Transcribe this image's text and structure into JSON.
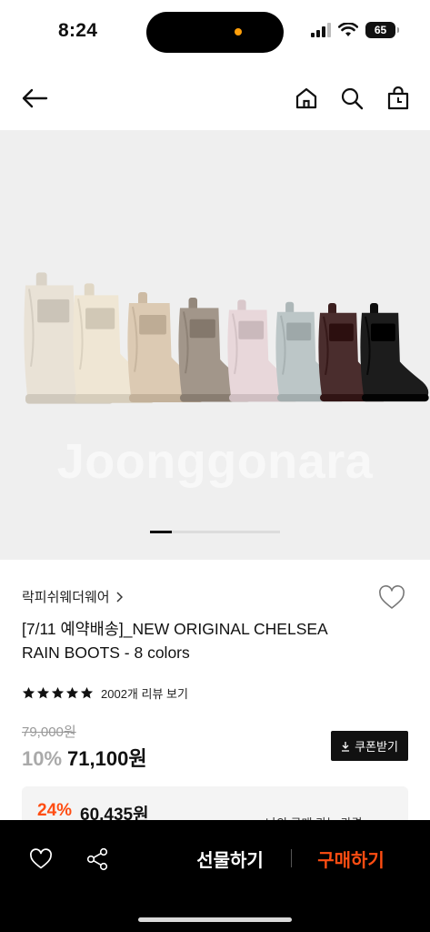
{
  "status_bar": {
    "time": "8:24",
    "battery": "65",
    "icons": [
      "signal-icon",
      "wifi-icon",
      "battery-icon"
    ]
  },
  "nav": {
    "icons": [
      "back-arrow-icon",
      "home-icon",
      "search-icon",
      "shopping-bag-icon"
    ]
  },
  "hero": {
    "watermark": "Joonggonara",
    "boot_colors": [
      "#e9e2d6",
      "#efe6d4",
      "#dccab3",
      "#a2968a",
      "#e8d7da",
      "#bcc6c7",
      "#4a2d2d",
      "#1c1c1c"
    ],
    "carousel_position": 0.05
  },
  "product": {
    "brand": "락피쉬웨더웨어",
    "title": "[7/11 예약배송]_NEW ORIGINAL CHELSEA RAIN BOOTS - 8 colors",
    "rating_stars": 5,
    "review_text": "2002개 리뷰 보기",
    "original_price": "79,000원",
    "discount_rate": "10%",
    "sale_price": "71,100원",
    "coupon_label": "쿠폰받기",
    "mypay": {
      "discount": "24%",
      "price": "60,435원",
      "label": "나의 구매 가능 가격"
    }
  },
  "bottom_bar": {
    "gift_label": "선물하기",
    "buy_label": "구매하기",
    "accent": "#ff4d12"
  }
}
